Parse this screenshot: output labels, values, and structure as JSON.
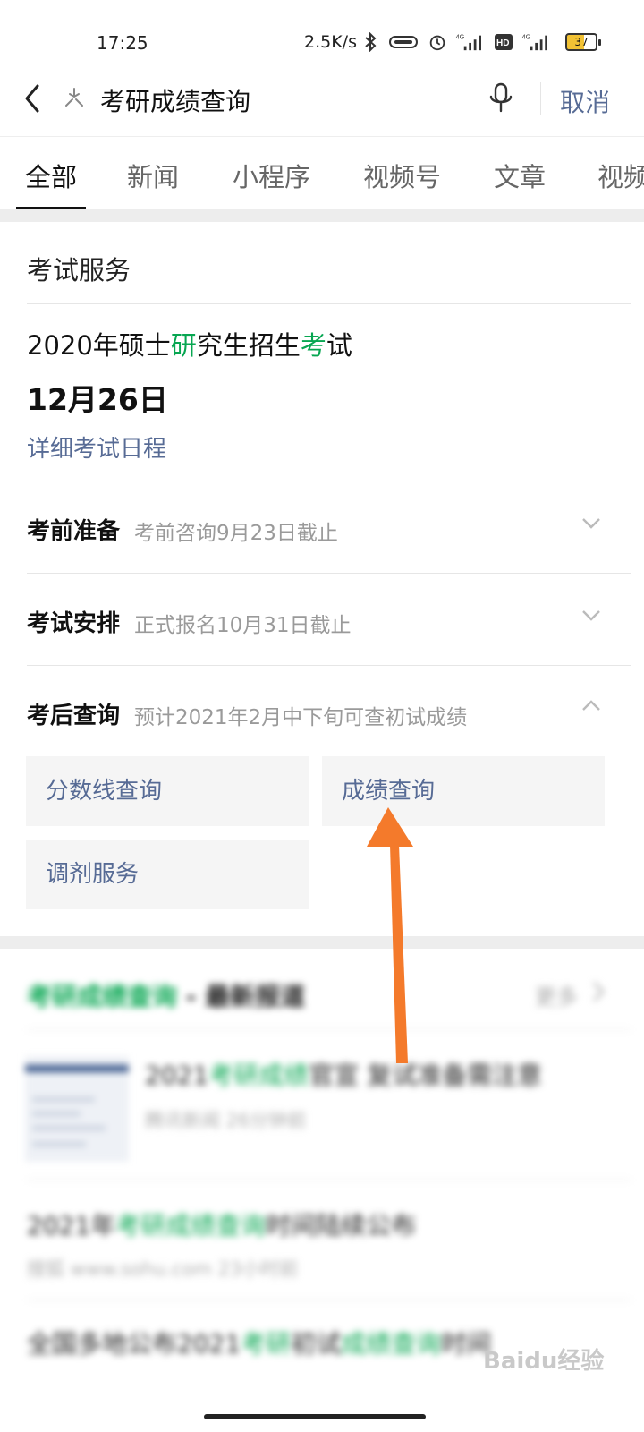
{
  "status_bar": {
    "time": "17:25",
    "network_speed": "2.5K/s",
    "battery": "37",
    "signal_label": "4G",
    "hd_label": "HD"
  },
  "search": {
    "query": "考研成绩查询",
    "cancel_label": "取消"
  },
  "tabs": [
    {
      "label": "全部",
      "active": true
    },
    {
      "label": "新闻"
    },
    {
      "label": "小程序"
    },
    {
      "label": "视频号"
    },
    {
      "label": "文章"
    },
    {
      "label": "视频"
    }
  ],
  "exam_card": {
    "title": "考试服务",
    "exam_name_parts": [
      "2020年硕士",
      "研",
      "究生招生",
      "考",
      "试"
    ],
    "exam_date": "12月26日",
    "schedule_link": "详细考试日程",
    "sections": [
      {
        "title": "考前准备",
        "subtitle": "考前咨询9月23日截止",
        "expanded": false
      },
      {
        "title": "考试安排",
        "subtitle": "正式报名10月31日截止",
        "expanded": false
      },
      {
        "title": "考后查询",
        "subtitle": "预计2021年2月中下旬可查初试成绩",
        "expanded": true
      }
    ],
    "buttons": [
      "分数线查询",
      "成绩查询",
      "调剂服务"
    ]
  },
  "news": {
    "header_green": "考研成绩查询",
    "header_rest": " - 最新报道",
    "more_label": "更多",
    "items": [
      {
        "title_parts": [
          "2021",
          "考研成绩",
          "官宣 复试准备需注意"
        ],
        "meta": "腾讯新闻  26分钟前"
      },
      {
        "title_parts": [
          "2021年",
          "考研成绩查询",
          "时间陆续公布"
        ],
        "meta": "搜狐 www.sohu.com  23小时前"
      },
      {
        "title_parts": [
          "全国多地公布2021",
          "考研",
          "初试",
          "成绩查询",
          "时间"
        ],
        "meta": ""
      }
    ]
  },
  "watermark": "Baidu经验",
  "colors": {
    "accent_green": "#07a651",
    "link_blue": "#576b95",
    "arrow_orange": "#f47a2b"
  }
}
